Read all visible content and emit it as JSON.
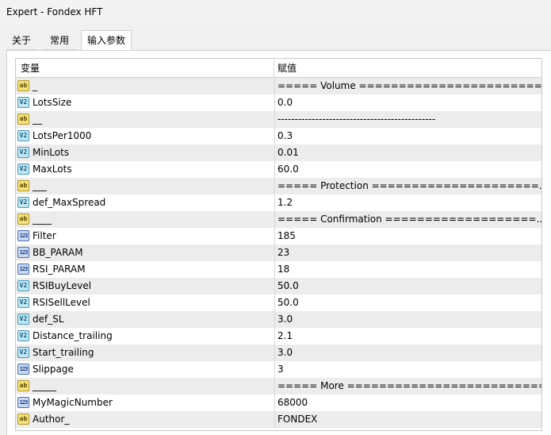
{
  "window": {
    "title": "Expert - Fondex HFT"
  },
  "tabs": [
    {
      "label": "关于",
      "active": false
    },
    {
      "label": "常用",
      "active": false
    },
    {
      "label": "输入参数",
      "active": true
    }
  ],
  "table": {
    "headers": {
      "variable": "变量",
      "value": "赋值"
    },
    "rows": [
      {
        "icon": "ab",
        "name": "_",
        "value": "===== Volume =======================..."
      },
      {
        "icon": "v2",
        "name": "LotsSize",
        "value": "0.0"
      },
      {
        "icon": "ab",
        "name": "__",
        "value": "----------------------------------------------"
      },
      {
        "icon": "v2",
        "name": "LotsPer1000",
        "value": "0.3"
      },
      {
        "icon": "v2",
        "name": "MinLots",
        "value": "0.01"
      },
      {
        "icon": "v2",
        "name": "MaxLots",
        "value": "60.0"
      },
      {
        "icon": "ab",
        "name": "___",
        "value": "===== Protection =====================..."
      },
      {
        "icon": "v2",
        "name": "def_MaxSpread",
        "value": "1.2"
      },
      {
        "icon": "ab",
        "name": "____",
        "value": "===== Confirmation ===================..."
      },
      {
        "icon": "123",
        "name": "Filter",
        "value": "185"
      },
      {
        "icon": "123",
        "name": "BB_PARAM",
        "value": "23"
      },
      {
        "icon": "123",
        "name": "RSI_PARAM",
        "value": "18"
      },
      {
        "icon": "v2",
        "name": "RSIBuyLevel",
        "value": "50.0"
      },
      {
        "icon": "v2",
        "name": "RSISellLevel",
        "value": "50.0"
      },
      {
        "icon": "v2",
        "name": "def_SL",
        "value": "3.0"
      },
      {
        "icon": "v2",
        "name": "Distance_trailing",
        "value": "2.1"
      },
      {
        "icon": "v2",
        "name": "Start_trailing",
        "value": "3.0"
      },
      {
        "icon": "123",
        "name": "Slippage",
        "value": "3"
      },
      {
        "icon": "ab",
        "name": "_____",
        "value": "===== More ==========================..."
      },
      {
        "icon": "123",
        "name": "MyMagicNumber",
        "value": "68000"
      },
      {
        "icon": "ab",
        "name": "Author_",
        "value": "FONDEX"
      }
    ]
  }
}
